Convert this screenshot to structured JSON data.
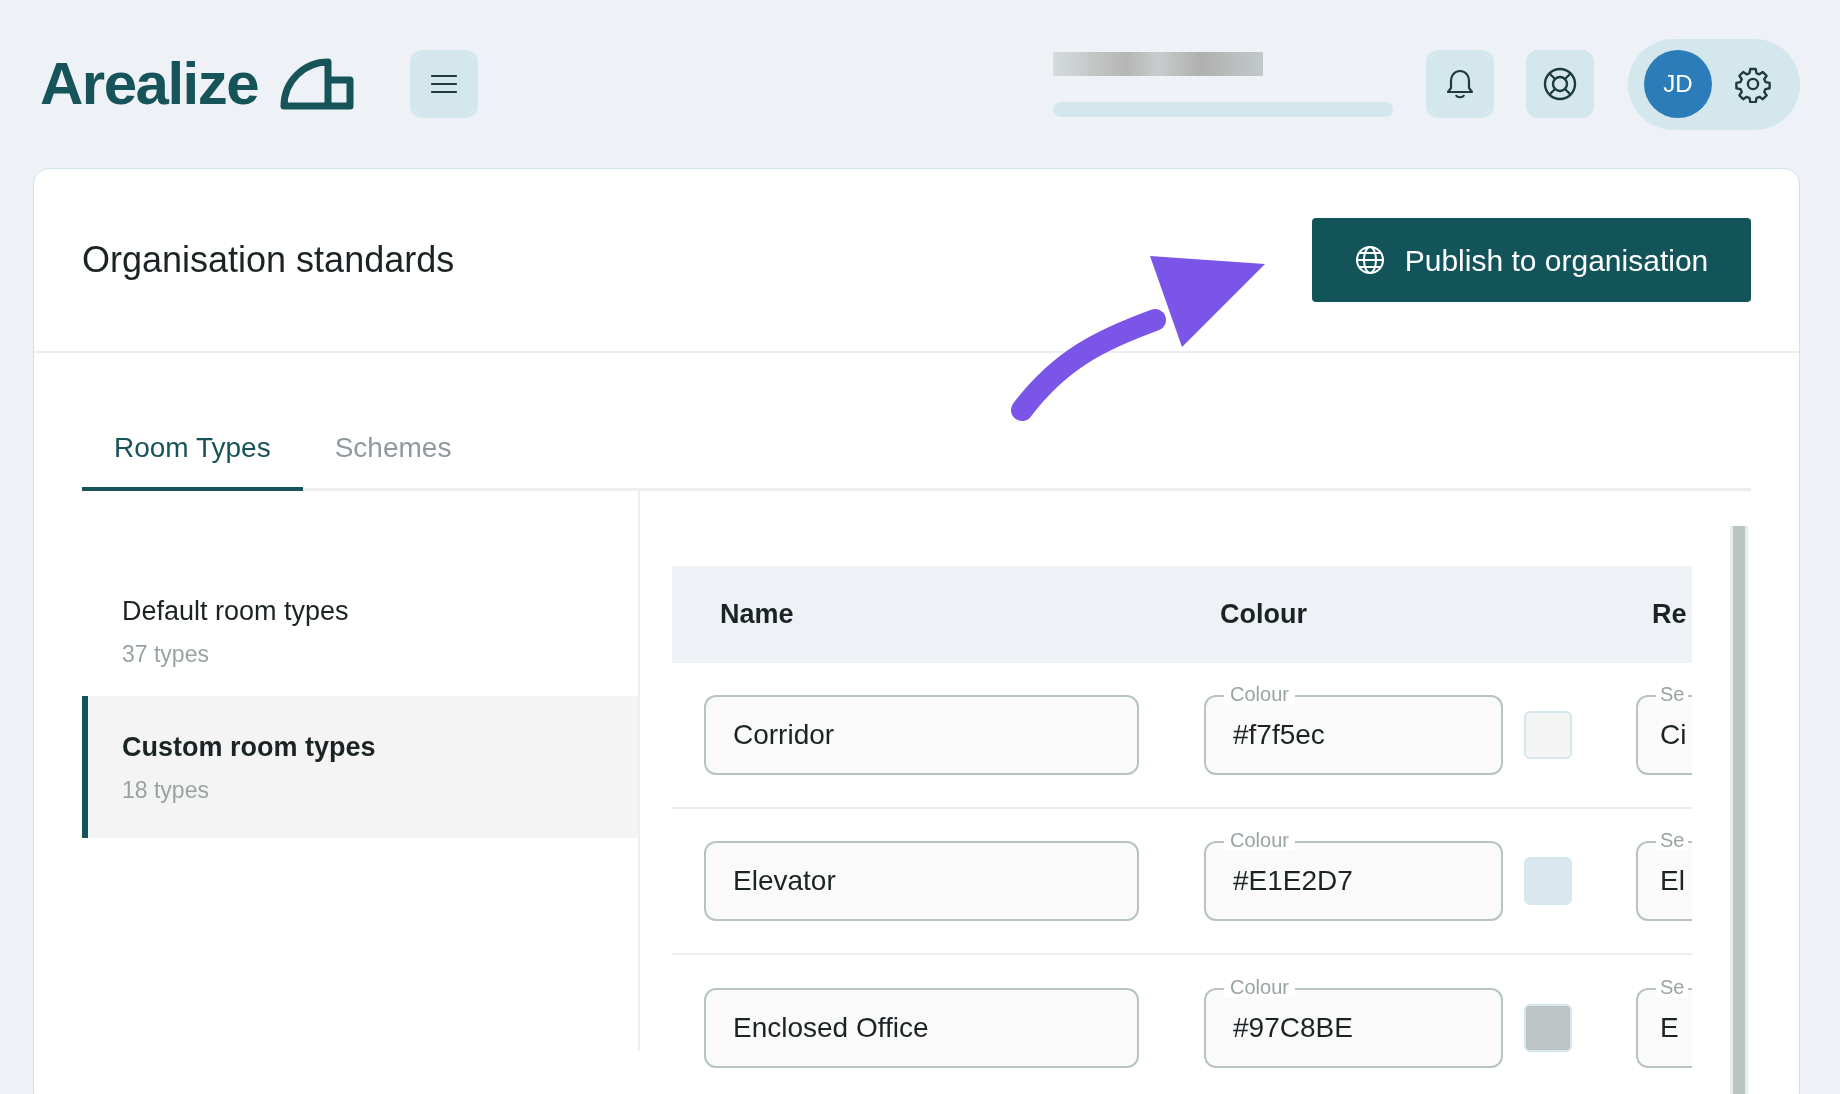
{
  "header": {
    "logo": "Arealize",
    "avatar_initials": "JD"
  },
  "page": {
    "title": "Organisation standards",
    "publish_button": "Publish to organisation"
  },
  "tabs": [
    {
      "label": "Room Types",
      "selected": true
    },
    {
      "label": "Schemes",
      "selected": false
    }
  ],
  "sidebar": {
    "items": [
      {
        "title": "Default room types",
        "count": "37 types",
        "selected": false
      },
      {
        "title": "Custom room types",
        "count": "18 types",
        "selected": true
      }
    ]
  },
  "table": {
    "columns": [
      "Name",
      "Colour",
      "Re"
    ],
    "rows": [
      {
        "name": "Corridor",
        "colour_label": "Colour",
        "colour": "#f7f5ec",
        "color": "#f4f4f4",
        "column_3_label": "Se",
        "column_3": "Ci"
      },
      {
        "name": "Elevator",
        "colour_label": "Colour",
        "colour": "#E1E2D7",
        "color": "#d9e8ee",
        "column_3_label": "Se",
        "column_3": "El"
      },
      {
        "name": "Enclosed Office",
        "colour_label": "Colour",
        "colour": "#97C8BE",
        "color": "#bdc5c4",
        "column_3_label": "Se",
        "column_3": "E"
      }
    ]
  }
}
